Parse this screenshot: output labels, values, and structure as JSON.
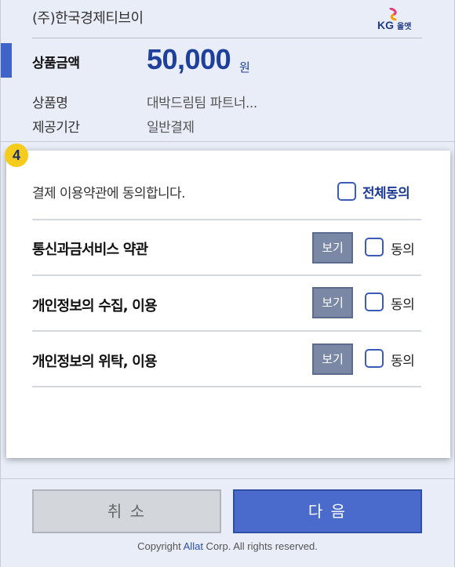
{
  "header": {
    "company": "(주)한국경제티브이",
    "logo": {
      "mark": "KG",
      "brand": "올앳",
      "icon": "kg-swoosh-icon"
    },
    "amount": {
      "label": "상품금액",
      "value": "50,000",
      "unit": "원"
    },
    "product": {
      "label": "상품명",
      "value": "대박드림팀 파트너..."
    },
    "period": {
      "label": "제공기간",
      "value": "일반결제"
    }
  },
  "terms": {
    "step": "4",
    "agree_all_text": "결제 이용약관에 동의합니다.",
    "agree_all_label": "전체동의",
    "items": [
      {
        "title": "통신과금서비스 약관",
        "view_label": "보기",
        "agree_label": "동의"
      },
      {
        "title": "개인정보의 수집, 이용",
        "view_label": "보기",
        "agree_label": "동의"
      },
      {
        "title": "개인정보의 위탁, 이용",
        "view_label": "보기",
        "agree_label": "동의"
      }
    ]
  },
  "footer": {
    "cancel_label": "취 소",
    "next_label": "다 음",
    "copyright_prefix": "Copyright ",
    "copyright_brand": "Allat",
    "copyright_suffix": " Corp. All rights reserved."
  },
  "colors": {
    "accent": "#3f64c9",
    "amount": "#1e3f9b",
    "badge": "#f5cc1e",
    "next_button": "#4a6bcc",
    "view_button": "#7a88a6"
  }
}
